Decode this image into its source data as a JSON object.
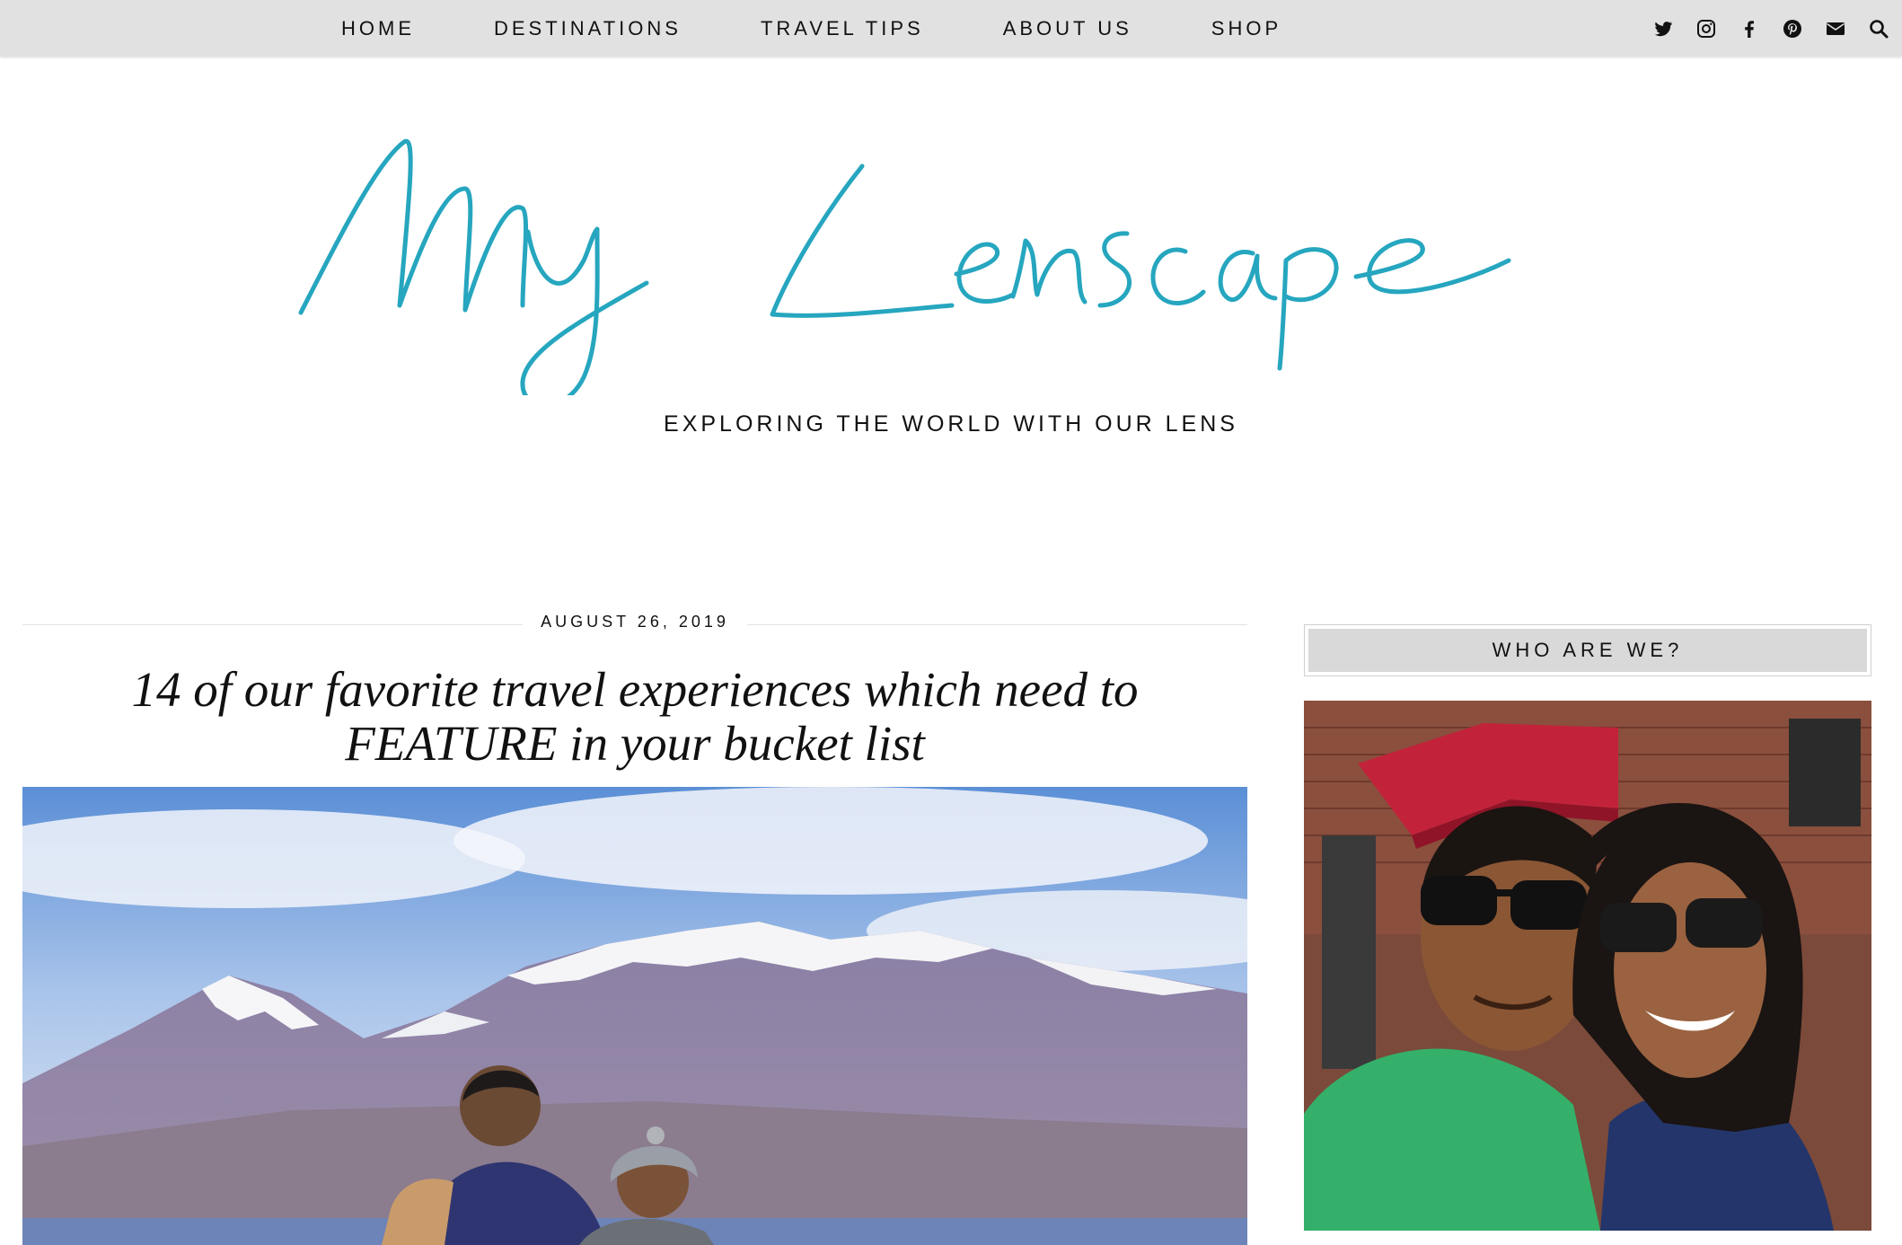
{
  "nav": {
    "items": [
      "HOME",
      "DESTINATIONS",
      "TRAVEL TIPS",
      "ABOUT US",
      "SHOP"
    ],
    "social_icons": [
      "twitter-icon",
      "instagram-icon",
      "facebook-icon",
      "pinterest-icon",
      "email-icon",
      "search-icon"
    ]
  },
  "header": {
    "logo_text": "My Lenscape",
    "tagline": "EXPLORING THE WORLD WITH OUR LENS",
    "logo_color": "#26a6bf"
  },
  "post": {
    "date": "AUGUST 26, 2019",
    "title": "14 of our favorite travel experiences which need to FEATURE in your bucket list"
  },
  "sidebar": {
    "widget_title": "WHO ARE WE?"
  },
  "colors": {
    "nav_bg": "#e1e1e1",
    "widget_title_bg": "#d9d9d9"
  }
}
